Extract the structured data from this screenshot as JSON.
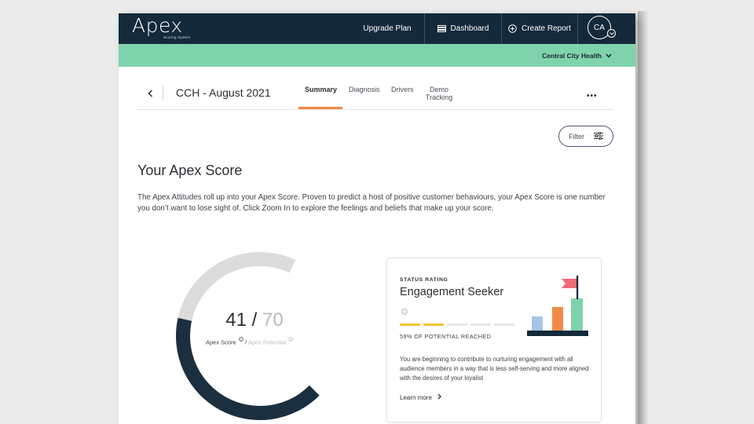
{
  "app": {
    "logo_text": "Apex",
    "logo_subtitle": "Scoring System"
  },
  "topnav": {
    "upgrade_label": "Upgrade Plan",
    "dashboard_label": "Dashboard",
    "create_report_label": "Create Report",
    "avatar_initials": "CA"
  },
  "orgbar": {
    "org_name": "Central City Health"
  },
  "report": {
    "title": "CCH - August 2021",
    "tabs": [
      {
        "label": "Summary",
        "active": true
      },
      {
        "label": "Diagnosis",
        "active": false
      },
      {
        "label": "Drivers",
        "active": false
      },
      {
        "label": "Demo\nTracking",
        "active": false
      }
    ],
    "more_label": "•••",
    "filter_label": "Filter"
  },
  "section": {
    "title": "Your Apex Score",
    "description": "The Apex Attitudes roll up into your Apex Score. Proven to predict a host of positive customer behaviours, your Apex Score is one number you don’t want to lose sight of. Click Zoom In to explore the feelings and beliefs that make up your score."
  },
  "score": {
    "value": "41",
    "separator": "/",
    "potential": "70",
    "score_label": "Apex Score",
    "slash_label": "/",
    "potential_label": "Apex Potential",
    "gauge_fill_fraction": 0.59
  },
  "status_card": {
    "kicker": "STATUS RATING",
    "title": "Engagement Seeker",
    "segments_filled": 2,
    "segments_total": 5,
    "progress_text": "59% OF POTENTIAL REACHED",
    "body": "You are beginning to contribute to nurturing engagement with all audience members in a way that is less self-serving and more aligned with the desires of your loyalist",
    "link_label": "Learn more"
  },
  "colors": {
    "nav_bg": "#14293a",
    "org_bar": "#7fd3ac",
    "tab_accent": "#f08a48",
    "gauge_fill": "#1b2f3f",
    "gauge_track": "#dcdcdc",
    "segment_on": "#f5c431",
    "filter_border": "#5a4a7a",
    "illus_blue": "#a9c3e6",
    "illus_orange": "#f08a48",
    "illus_green": "#7fd3ac",
    "illus_flag": "#f06b7a"
  },
  "icons": {
    "dashboard": "dashboard-icon",
    "create_report": "plus-circle-icon",
    "filter": "sliders-icon",
    "back": "chevron-left-icon",
    "org_dropdown": "chevron-down-icon",
    "learn_more": "chevron-right-icon",
    "info": "info-icon"
  }
}
